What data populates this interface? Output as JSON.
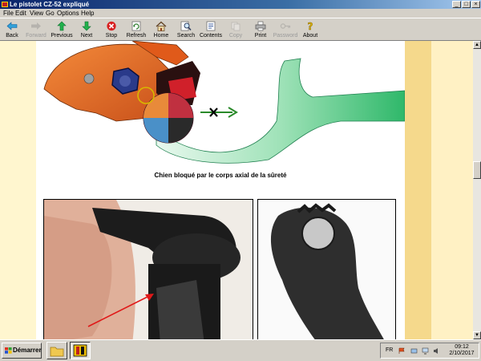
{
  "window": {
    "title": "Le pistolet CZ-52 expliqué"
  },
  "menu": [
    "File",
    "Edit",
    "View",
    "Go",
    "Options",
    "Help"
  ],
  "toolbar": [
    {
      "label": "Back",
      "icon": "back-arrow-icon",
      "enabled": true
    },
    {
      "label": "Forward",
      "icon": "forward-arrow-icon",
      "enabled": false
    },
    {
      "label": "Previous",
      "icon": "previous-arrow-icon",
      "enabled": true
    },
    {
      "label": "Next",
      "icon": "next-arrow-icon",
      "enabled": true
    },
    {
      "label": "Stop",
      "icon": "stop-icon",
      "enabled": true
    },
    {
      "label": "Refresh",
      "icon": "refresh-icon",
      "enabled": true
    },
    {
      "label": "Home",
      "icon": "home-icon",
      "enabled": true
    },
    {
      "label": "Search",
      "icon": "search-icon",
      "enabled": true
    },
    {
      "label": "Contents",
      "icon": "contents-icon",
      "enabled": true
    },
    {
      "label": "Copy",
      "icon": "copy-icon",
      "enabled": false
    },
    {
      "label": "Print",
      "icon": "print-icon",
      "enabled": true
    },
    {
      "label": "Password",
      "icon": "password-key-icon",
      "enabled": false
    },
    {
      "label": "About",
      "icon": "about-icon",
      "enabled": true
    }
  ],
  "page": {
    "caption": "Chien bloqué par le corps axial de la sûreté"
  },
  "taskbar": {
    "start": "Démarrer",
    "language": "FR",
    "time": "09:12",
    "date": "2/10/2017"
  },
  "colors": {
    "accent_green": "#3fc47a",
    "hammer_orange": "#e86a1e",
    "band_gold": "#f5d98c",
    "band_cream": "#fff1c4"
  }
}
